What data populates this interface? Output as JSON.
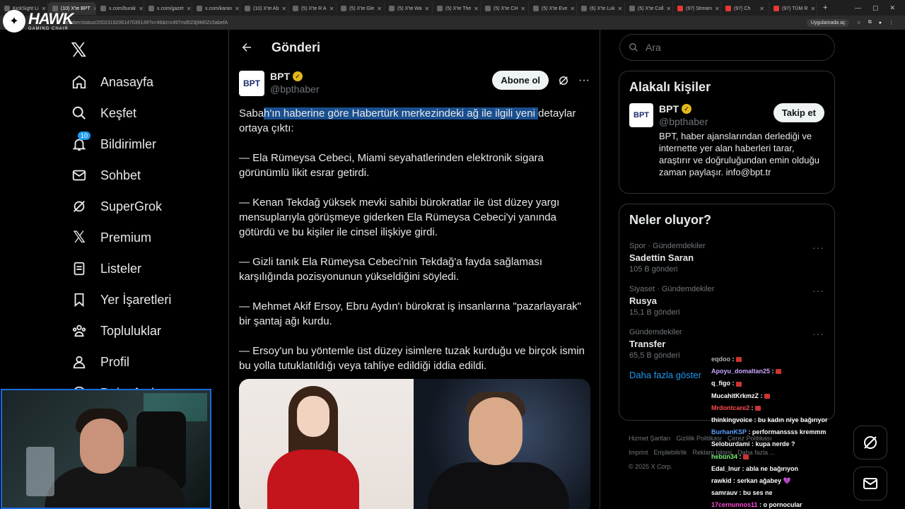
{
  "browser": {
    "tabs": [
      {
        "label": "KickSight Li",
        "fav": ""
      },
      {
        "label": "(10) X'te BPT",
        "fav": "",
        "active": true
      },
      {
        "label": "x.com/burak",
        "fav": ""
      },
      {
        "label": "x.com/gazet",
        "fav": ""
      },
      {
        "label": "x.com/karan",
        "fav": ""
      },
      {
        "label": "(10) X'te Ab",
        "fav": ""
      },
      {
        "label": "(5) X'te R A",
        "fav": ""
      },
      {
        "label": "(5) X'te Gle",
        "fav": ""
      },
      {
        "label": "(5) X'te Wa",
        "fav": ""
      },
      {
        "label": "(5) X'te The",
        "fav": ""
      },
      {
        "label": "(5) X'te CH",
        "fav": ""
      },
      {
        "label": "(5) X'te Eve",
        "fav": ""
      },
      {
        "label": "(6) X'te Luk",
        "fav": ""
      },
      {
        "label": "(5) X'te Coll",
        "fav": ""
      },
      {
        "label": "(97) Stream",
        "fav": "red"
      },
      {
        "label": "(97) Ch",
        "fav": "red"
      },
      {
        "label": "(97) TÜM R",
        "fav": "red"
      }
    ],
    "url": "bptaber/status/2002319206147035149?s=46&t=z497md5Z8j9M0Zc5abefA",
    "app_badge": "Uygulamada aç"
  },
  "logo": {
    "brand": "HAWK",
    "sub": "GAMING CHAIR"
  },
  "nav": {
    "x_logo": "𝕏",
    "items": [
      {
        "label": "Anasayfa",
        "icon": "home-icon"
      },
      {
        "label": "Keşfet",
        "icon": "search-icon"
      },
      {
        "label": "Bildirimler",
        "icon": "bell-icon",
        "badge": "10"
      },
      {
        "label": "Sohbet",
        "icon": "mail-icon"
      },
      {
        "label": "SuperGrok",
        "icon": "grok-icon"
      },
      {
        "label": "Premium",
        "icon": "x-icon"
      },
      {
        "label": "Listeler",
        "icon": "list-icon"
      },
      {
        "label": "Yer İşaretleri",
        "icon": "bookmark-icon"
      },
      {
        "label": "Topluluklar",
        "icon": "communities-icon"
      },
      {
        "label": "Profil",
        "icon": "profile-icon"
      },
      {
        "label": "Daha fazla",
        "icon": "more-icon"
      }
    ]
  },
  "post": {
    "header": "Gönderi",
    "author_name": "BPT",
    "author_handle": "@bpthaber",
    "avatar_text": "BPT",
    "subscribe_label": "Abone ol",
    "text_pre": "Saba",
    "text_hl": "h'ın haberine göre Habertürk merkezindeki ağ ile ilgili yeni ",
    "text_post": "detaylar ortaya çıktı:",
    "paragraphs": [
      "— Ela Rümeysa Cebeci, Miami seyahatlerinden elektronik sigara görünümlü likit esrar getirdi.",
      "— Kenan Tekdağ yüksek mevki sahibi bürokratlar ile üst düzey yargı mensuplarıyla görüşmeye giderken Ela Rümeysa Cebeci'yi yanında götürdü ve bu kişiler ile cinsel ilişkiye girdi.",
      "— Gizli tanık Ela Rümeysa Cebeci'nin Tekdağ'a fayda sağlaması karşılığında pozisyonunun yükseldiğini söyledi.",
      "— Mehmet Akif Ersoy, Ebru Aydın'ı bürokrat iş insanlarına \"pazarlayarak\" bir şantaj ağı kurdu.",
      "— Ersoy'un bu yöntemle üst düzey isimlere tuzak kurduğu ve birçok ismin bu yolla tutuklatıldığı veya tahliye edildiği iddia edildi."
    ]
  },
  "search": {
    "placeholder": "Ara"
  },
  "related": {
    "title": "Alakalı kişiler",
    "name": "BPT",
    "handle": "@bpthaber",
    "avatar_text": "BPT",
    "follow_label": "Takip et",
    "bio": "BPT, haber ajanslarından derlediği ve internette yer alan haberleri tarar, araştırır ve doğruluğundan emin olduğu zaman paylaşır. info@bpt.tr"
  },
  "trends": {
    "title": "Neler oluyor?",
    "items": [
      {
        "meta": "Spor · Gündemdekiler",
        "name": "Sadettin Saran",
        "count": "105 B gönderi"
      },
      {
        "meta": "Siyaset · Gündemdekiler",
        "name": "Rusya",
        "count": "15,1 B gönderi"
      },
      {
        "meta": "Gündemdekiler",
        "name": "Transfer",
        "count": "65,5 B gönderi"
      }
    ],
    "more": "Daha fazla göster"
  },
  "footer": {
    "links": [
      "Hizmet Şartları",
      "Gizlilik Politikası",
      "Çerez Politikası",
      "Imprint",
      "Erişilebilirlik",
      "Reklam bilgisi",
      "Daha fazla ..."
    ],
    "copyright": "© 2025 X Corp."
  },
  "chat": [
    {
      "user": "eqdoo",
      "color": "#b0b0b0",
      "msg": ":"
    },
    {
      "user": "Apoyu_domaltan25",
      "color": "#c9a6ff",
      "msg": ":"
    },
    {
      "user": "q_figo",
      "color": "#ffffff",
      "msg": ":"
    },
    {
      "user": "MucahitKrkmzZ",
      "color": "#ffffff",
      "msg": ":"
    },
    {
      "user": "Mrdontcare2",
      "color": "#ff4d4d",
      "msg": ":"
    },
    {
      "user": "thinkingvoice",
      "color": "#ffffff",
      "msg": ": bu kadın niye bağırıyor"
    },
    {
      "user": "BurhanKSP",
      "color": "#5ea0ff",
      "msg": ": performanssss kremmm"
    },
    {
      "user": "Seloburdami",
      "color": "#ffffff",
      "msg": ": kupa nerde ?"
    },
    {
      "user": "hebun34",
      "color": "#7cf07c",
      "msg": ":"
    },
    {
      "user": "Edal_Inur",
      "color": "#ffffff",
      "msg": ": abla ne bağırıyon"
    },
    {
      "user": "rawkid",
      "color": "#ffffff",
      "msg": ": serkan ağabey 💜"
    },
    {
      "user": "samrauv",
      "color": "#ffffff",
      "msg": ": bu ses ne"
    },
    {
      "user": "17cernunnos11",
      "color": "#ff4dd2",
      "msg": ": o pornocular"
    }
  ]
}
